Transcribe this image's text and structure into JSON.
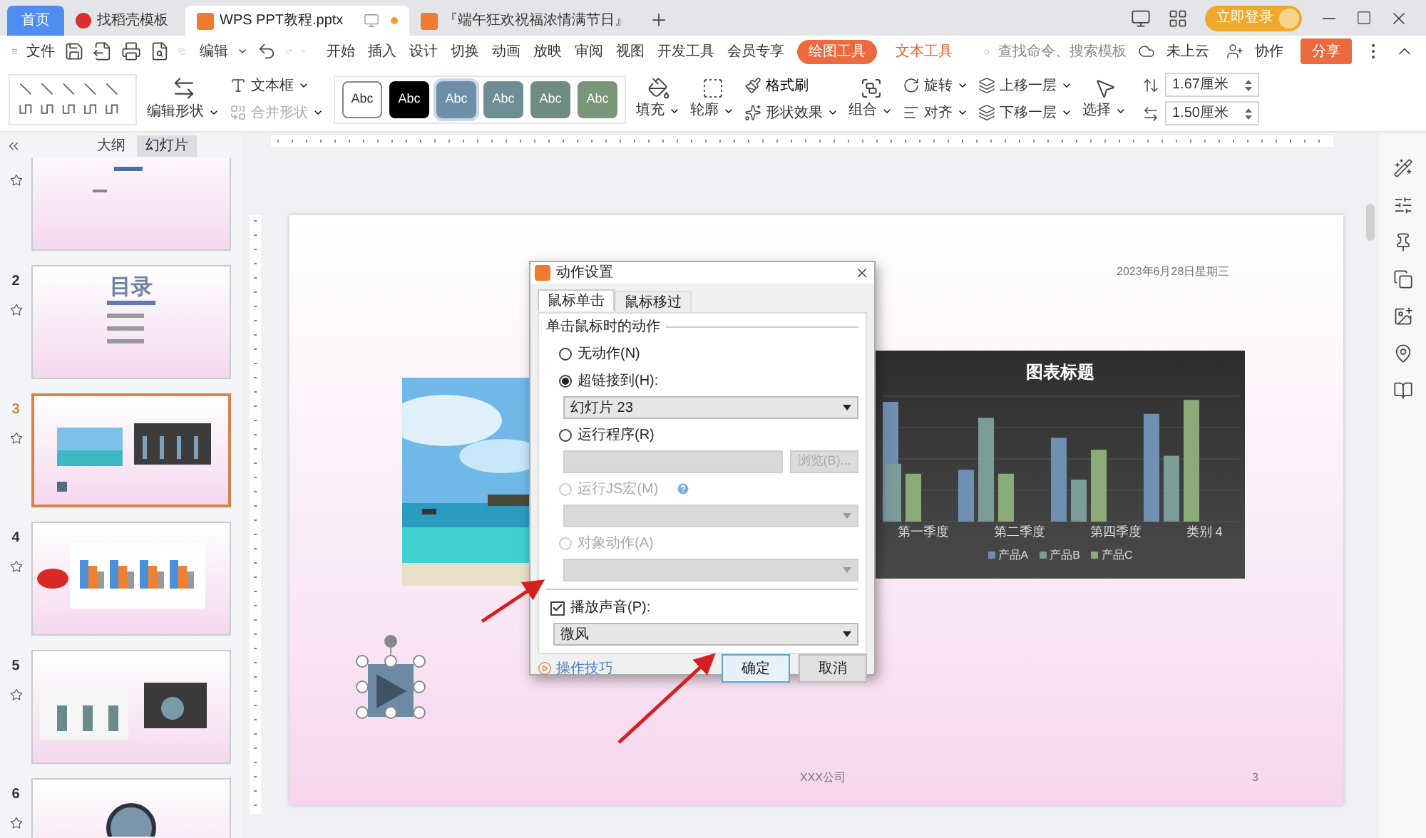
{
  "tabs": [
    {
      "label": "首页",
      "kind": "home",
      "selected": false
    },
    {
      "label": "找稻壳模板",
      "kind": "docer",
      "selected": false
    },
    {
      "label": "WPS PPT教程.pptx",
      "kind": "doc",
      "selected": true
    },
    {
      "label": "『端午狂欢祝福浓情满节日』",
      "kind": "doc",
      "selected": false
    }
  ],
  "login": "立即登录",
  "menu": {
    "file": "文件",
    "edit": "编辑",
    "tabs": [
      {
        "label": "开始",
        "kind": "normal",
        "selected": false
      },
      {
        "label": "插入",
        "kind": "normal",
        "selected": false
      },
      {
        "label": "设计",
        "kind": "normal",
        "selected": false
      },
      {
        "label": "切换",
        "kind": "normal",
        "selected": false
      },
      {
        "label": "动画",
        "kind": "normal",
        "selected": false
      },
      {
        "label": "放映",
        "kind": "normal",
        "selected": false
      },
      {
        "label": "审阅",
        "kind": "normal",
        "selected": false
      },
      {
        "label": "视图",
        "kind": "normal",
        "selected": false
      },
      {
        "label": "开发工具",
        "kind": "normal",
        "selected": false
      },
      {
        "label": "会员专享",
        "kind": "normal",
        "selected": false
      },
      {
        "label": "绘图工具",
        "kind": "context",
        "selected": true
      },
      {
        "label": "文本工具",
        "kind": "context",
        "selected": false
      }
    ],
    "search": {
      "placeholder": "查找命令、搜索模板"
    },
    "cloud": "未上云",
    "collab": "协作",
    "share": "分享"
  },
  "ribbon": {
    "edit_shape": "编辑形状",
    "textbox": "文本框",
    "merge_shape": {
      "label": "合并形状",
      "disabled": true
    },
    "styles": [
      {
        "label": "Abc",
        "color": "#ffffff",
        "selected": false
      },
      {
        "label": "Abc",
        "color": "#000000",
        "selected": false
      },
      {
        "label": "Abc",
        "color": "#6f8fa9",
        "selected": true
      },
      {
        "label": "Abc",
        "color": "#6f8d95",
        "selected": false
      },
      {
        "label": "Abc",
        "color": "#6e8c84",
        "selected": false
      },
      {
        "label": "Abc",
        "color": "#789578",
        "selected": false
      }
    ],
    "fill": "填充",
    "outline": "轮廓",
    "format_painter": "格式刷",
    "shape_effect": "形状效果",
    "group": "组合",
    "rotate": "旋转",
    "align": "对齐",
    "bring_forward": "上移一层",
    "send_backward": "下移一层",
    "select": "选择",
    "height": "1.67厘米",
    "width": "1.50厘米"
  },
  "panel": {
    "tabs": [
      {
        "label": "大纲",
        "selected": false
      },
      {
        "label": "幻灯片",
        "selected": true
      }
    ],
    "slides": [
      {
        "kind": "title",
        "selected": false
      },
      {
        "number": "2",
        "kind": "toc",
        "title": "目录",
        "selected": false
      },
      {
        "number": "3",
        "kind": "media",
        "selected": true
      },
      {
        "number": "4",
        "kind": "chart",
        "selected": false
      },
      {
        "number": "5",
        "kind": "charts",
        "selected": false
      },
      {
        "number": "6",
        "kind": "donut",
        "selected": false
      }
    ]
  },
  "slide": {
    "date": "2023年6月28日星期三",
    "chart": {
      "title": "图表标题",
      "categories": [
        "第一季度",
        "第二季度",
        "第四季度",
        "类别 4"
      ],
      "legend": [
        {
          "name": "产品A",
          "color": "#6f8fb3"
        },
        {
          "name": "产品B",
          "color": "#7b9c98"
        },
        {
          "name": "产品C",
          "color": "#8aab78"
        }
      ]
    },
    "footer": "XXX公司",
    "page": "3"
  },
  "dialog": {
    "title": "动作设置",
    "tabs": [
      {
        "label": "鼠标单击",
        "selected": true
      },
      {
        "label": "鼠标移过",
        "selected": false
      }
    ],
    "group": "单击鼠标时的动作",
    "options": [
      {
        "label": "无动作(N)",
        "selected": false,
        "disabled": false
      },
      {
        "label": "超链接到(H):",
        "selected": true,
        "disabled": false,
        "field": {
          "kind": "select",
          "value": "幻灯片 23",
          "disabled": false
        }
      },
      {
        "label": "运行程序(R)",
        "selected": false,
        "disabled": false,
        "field": {
          "kind": "input",
          "disabled": true,
          "button": "浏览(B)..."
        }
      },
      {
        "label": "运行JS宏(M)",
        "selected": false,
        "disabled": true,
        "help": true,
        "field": {
          "kind": "select",
          "disabled": true
        }
      },
      {
        "label": "对象动作(A)",
        "selected": false,
        "disabled": true,
        "field": {
          "kind": "select",
          "disabled": true
        }
      }
    ],
    "sound": {
      "label": "播放声音(P):",
      "checked": true,
      "value": "微风"
    },
    "tips": "操作技巧",
    "ok": "确定",
    "cancel": "取消"
  }
}
